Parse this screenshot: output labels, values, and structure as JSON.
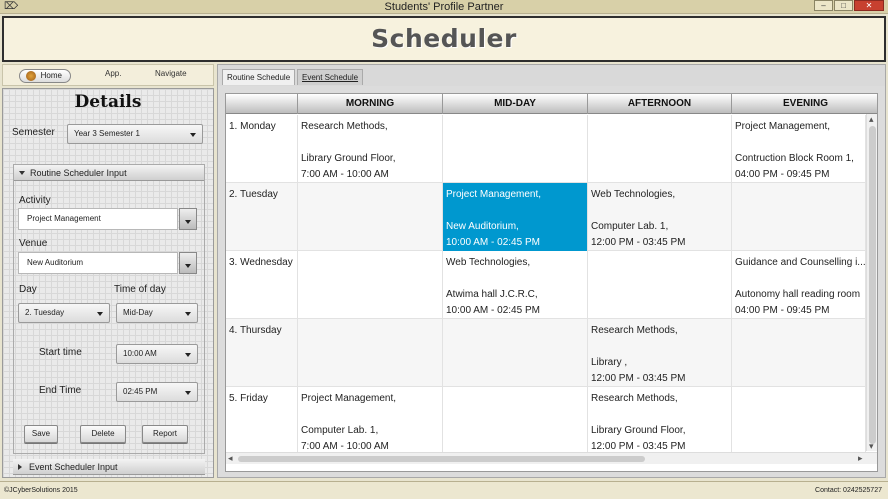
{
  "window": {
    "title": "Students' Profile Partner",
    "minimize": "–",
    "maximize": "□",
    "close": "✕"
  },
  "header": {
    "title": "Scheduler"
  },
  "nav": {
    "home": "Home",
    "app": "App.",
    "navigate": "Navigate"
  },
  "details": {
    "title": "Details",
    "semester_label": "Semester",
    "semester_value": "Year 3 Semester 1",
    "routine_section": "Routine Scheduler Input",
    "event_section": "Event Scheduler Input",
    "activity_label": "Activity",
    "activity_value": "Project Management",
    "venue_label": "Venue",
    "venue_value": "New Auditorium",
    "day_label": "Day",
    "day_value": "2. Tuesday",
    "time_of_day_label": "Time of day",
    "time_of_day_value": "Mid-Day",
    "start_label": "Start time",
    "start_value": "10:00 AM",
    "end_label": "End Time",
    "end_value": "02:45 PM",
    "save": "Save",
    "delete": "Delete",
    "report": "Report"
  },
  "tabs": {
    "routine": "Routine Schedule",
    "event": "Event Schedule"
  },
  "table": {
    "columns": [
      "",
      "MORNING",
      "MID-DAY",
      "AFTERNOON",
      "EVENING"
    ],
    "rows": [
      {
        "day": "1. Monday",
        "cells": [
          [
            "Research Methods,",
            "",
            "Library Ground Floor,",
            "7:00 AM - 10:00 AM"
          ],
          [
            "",
            "",
            "",
            ""
          ],
          [
            "",
            "",
            "",
            ""
          ],
          [
            "Project Management,",
            "",
            "Contruction Block Room 1,",
            "04:00 PM - 09:45 PM"
          ]
        ]
      },
      {
        "day": "2. Tuesday",
        "cells": [
          [
            "",
            "",
            "",
            ""
          ],
          [
            "Project Management,",
            "",
            "New Auditorium,",
            "10:00 AM - 02:45 PM"
          ],
          [
            "Web Technologies,",
            "",
            "Computer Lab. 1,",
            "12:00 PM - 03:45 PM"
          ],
          [
            "",
            "",
            "",
            ""
          ]
        ]
      },
      {
        "day": "3. Wednesday",
        "cells": [
          [
            "",
            "",
            "",
            ""
          ],
          [
            "Web Technologies,",
            "",
            "Atwima hall J.C.R.C,",
            "10:00 AM - 02:45 PM"
          ],
          [
            "",
            "",
            "",
            ""
          ],
          [
            "Guidance and Counselling i...",
            "",
            "Autonomy hall reading room",
            "04:00 PM - 09:45 PM"
          ]
        ]
      },
      {
        "day": "4. Thursday",
        "cells": [
          [
            "",
            "",
            "",
            ""
          ],
          [
            "",
            "",
            "",
            ""
          ],
          [
            "Research Methods,",
            "",
            "Library ,",
            "12:00 PM - 03:45 PM"
          ],
          [
            "",
            "",
            "",
            ""
          ]
        ]
      },
      {
        "day": "5. Friday",
        "cells": [
          [
            "Project Management,",
            "",
            "Computer Lab. 1,",
            "7:00 AM - 10:00 AM"
          ],
          [
            "",
            "",
            "",
            ""
          ],
          [
            "Research Methods,",
            "",
            "Library Ground Floor,",
            "12:00 PM - 03:45 PM"
          ],
          [
            "",
            "",
            "",
            ""
          ]
        ]
      }
    ]
  },
  "status": {
    "copyright": "©JCyberSolutions 2015",
    "contact": "Contact: 0242525727"
  },
  "colors": {
    "highlight": "#0098cf",
    "background": "#e8e4cf"
  }
}
